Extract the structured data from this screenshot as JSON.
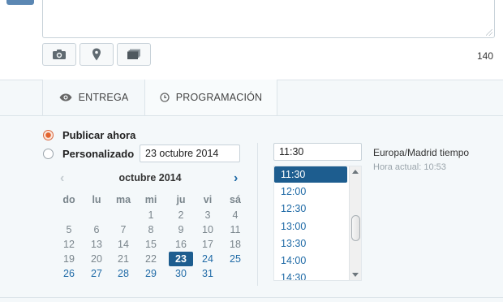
{
  "composer": {
    "char_count": "140",
    "tools": [
      {
        "name": "camera-icon"
      },
      {
        "name": "location-pin-icon"
      },
      {
        "name": "gallery-icon"
      }
    ]
  },
  "tabs": [
    {
      "label": "ENTREGA",
      "icon": "eye-icon",
      "active": true
    },
    {
      "label": "PROGRAMACIÓN",
      "icon": "clock-icon",
      "active": false
    }
  ],
  "schedule": {
    "publish_now_label": "Publicar ahora",
    "custom_label": "Personalizado",
    "date_value": "23 octubre 2014",
    "selected_option": "publish_now"
  },
  "calendar": {
    "month_title": "octubre 2014",
    "weekdays": [
      "do",
      "lu",
      "ma",
      "mi",
      "ju",
      "vi",
      "sá"
    ],
    "weeks": [
      [
        "",
        "",
        "",
        "1",
        "2",
        "3",
        "4"
      ],
      [
        "5",
        "6",
        "7",
        "8",
        "9",
        "10",
        "11"
      ],
      [
        "12",
        "13",
        "14",
        "15",
        "16",
        "17",
        "18"
      ],
      [
        "19",
        "20",
        "21",
        "22",
        "23",
        "24",
        "25"
      ],
      [
        "26",
        "27",
        "28",
        "29",
        "30",
        "31",
        ""
      ]
    ],
    "selected_day": "23",
    "prev_enabled": false,
    "next_enabled": true
  },
  "time": {
    "value": "11:30",
    "options": [
      "11:30",
      "12:00",
      "12:30",
      "13:00",
      "13:30",
      "14:00",
      "14:30"
    ],
    "selected": "11:30",
    "timezone_label": "Europa/Madrid tiempo",
    "current_time_label": "Hora actual: 10:53"
  },
  "colors": {
    "accent_blue": "#1d5d8f",
    "link_blue": "#1f6aa6",
    "radio_orange": "#e2632e"
  }
}
